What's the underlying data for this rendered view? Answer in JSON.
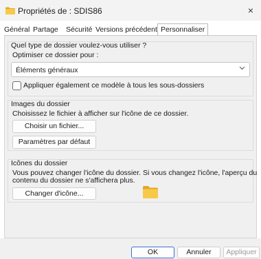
{
  "window": {
    "title": "Propriétés de : SDIS86",
    "close_glyph": "×"
  },
  "tabs": [
    {
      "label": "Général"
    },
    {
      "label": "Partage"
    },
    {
      "label": "Sécurité"
    },
    {
      "label": "Versions précédentes"
    },
    {
      "label": "Personnaliser",
      "active": true
    }
  ],
  "folder_type": {
    "title": "Quel type de dossier voulez-vous utiliser ?",
    "optimize_label": "Optimiser ce dossier pour :",
    "selected_option": "Éléments généraux",
    "apply_all_label": "Appliquer également ce modèle à tous les sous-dossiers",
    "apply_all_checked": false
  },
  "folder_images": {
    "title": "Images du dossier",
    "description": "Choisissez le fichier à afficher sur l'icône de ce dossier.",
    "choose_file_button": "Choisir un fichier...",
    "restore_default_button": "Paramètres par défaut"
  },
  "folder_icons": {
    "title": "Icônes du dossier",
    "description_line1": "Vous pouvez changer l'icône du dossier. Si vous changez l'icône, l'aperçu du",
    "description_line2": "contenu du dossier ne s'affichera plus.",
    "change_icon_button": "Changer d'icône..."
  },
  "footer": {
    "ok": "OK",
    "cancel": "Annuler",
    "apply": "Appliquer"
  },
  "colors": {
    "folder_yellow": "#f7c948",
    "folder_dark": "#e0a82b",
    "accent": "#3c6fd8"
  }
}
